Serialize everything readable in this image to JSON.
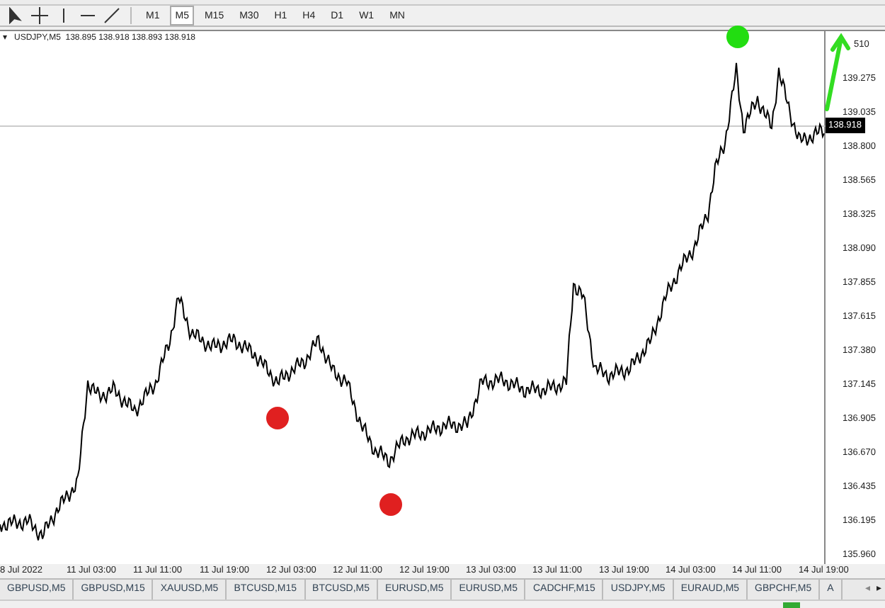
{
  "toolbar": {
    "timeframes": [
      {
        "label": "M1",
        "selected": false
      },
      {
        "label": "M5",
        "selected": true
      },
      {
        "label": "M15",
        "selected": false
      },
      {
        "label": "M30",
        "selected": false
      },
      {
        "label": "H1",
        "selected": false
      },
      {
        "label": "H4",
        "selected": false
      },
      {
        "label": "D1",
        "selected": false
      },
      {
        "label": "W1",
        "selected": false
      },
      {
        "label": "MN",
        "selected": false
      }
    ]
  },
  "chart": {
    "menu_glyph": "▾",
    "title": "USDJPY,M5  138.895 138.918 138.893 138.918",
    "current_price": "138.918",
    "price_labels": [
      "510",
      "139.275",
      "139.035",
      "138.800",
      "138.565",
      "138.325",
      "138.090",
      "137.855",
      "137.615",
      "137.380",
      "137.145",
      "136.905",
      "136.670",
      "136.435",
      "136.195",
      "135.960"
    ],
    "time_labels": [
      "8 Jul 2022",
      "11 Jul 03:00",
      "11 Jul 11:00",
      "11 Jul 19:00",
      "12 Jul 03:00",
      "12 Jul 11:00",
      "12 Jul 19:00",
      "13 Jul 03:00",
      "13 Jul 11:00",
      "13 Jul 19:00",
      "14 Jul 03:00",
      "14 Jul 11:00",
      "14 Jul 19:00"
    ],
    "markers": [
      {
        "kind": "dot",
        "color": "#22dd11"
      },
      {
        "kind": "dot",
        "color": "#e02020"
      },
      {
        "kind": "dot",
        "color": "#e02020"
      },
      {
        "kind": "arrow",
        "color": "#33dd22"
      }
    ]
  },
  "tabs": {
    "items": [
      "GBPUSD,M5",
      "GBPUSD,M15",
      "XAUUSD,M5",
      "BTCUSD,M15",
      "BTCUSD,M5",
      "EURUSD,M5",
      "EURUSD,M5",
      "CADCHF,M15",
      "USDJPY,M5",
      "EURAUD,M5",
      "GBPCHF,M5",
      "A"
    ],
    "scroll_left": "◂",
    "scroll_right": "▸"
  }
}
